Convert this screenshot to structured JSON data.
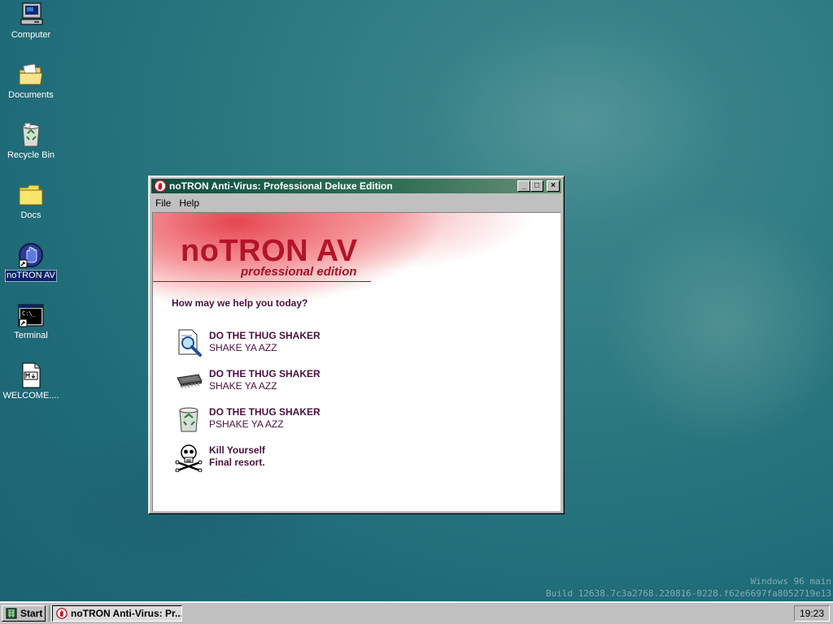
{
  "desktop": {
    "icons": [
      {
        "label": "Computer"
      },
      {
        "label": "Documents"
      },
      {
        "label": "Recycle Bin"
      },
      {
        "label": "Docs"
      },
      {
        "label": "noTRON AV",
        "selected": true
      },
      {
        "label": "Terminal"
      },
      {
        "label": "WELCOME...."
      }
    ],
    "build_info": {
      "line1": "Windows 96 main",
      "line2": "Build 12638.7c3a2768.220816-0228.f62e6697fa8052719e13"
    }
  },
  "window": {
    "title": "noTRON Anti-Virus: Professional Deluxe Edition",
    "menu": [
      "File",
      "Help"
    ],
    "controls": {
      "minimize": "_",
      "maximize": "□",
      "close": "×"
    },
    "brand": {
      "name": "noTRON AV",
      "edition": "professional edition",
      "color": "#b3142a"
    },
    "prompt": "How may we help you today?",
    "options": [
      {
        "icon": "magnifier-document-icon",
        "title": "DO THE THUG SHAKER",
        "subtitle": "SHAKE YA AZZ"
      },
      {
        "icon": "memory-chip-icon",
        "title": "DO THE THUG SHAKER",
        "subtitle": "SHAKE YA AZZ"
      },
      {
        "icon": "recycle-bin-icon",
        "title": "DO THE THUG SHAKER",
        "subtitle": "PSHAKE YA AZZ"
      },
      {
        "icon": "skull-crossbones-icon",
        "title": "Kill Yourself",
        "subtitle": "Final resort."
      }
    ]
  },
  "taskbar": {
    "start_label": "Start",
    "task_label": "noTRON Anti-Virus: Pr...",
    "clock": "19:23"
  }
}
